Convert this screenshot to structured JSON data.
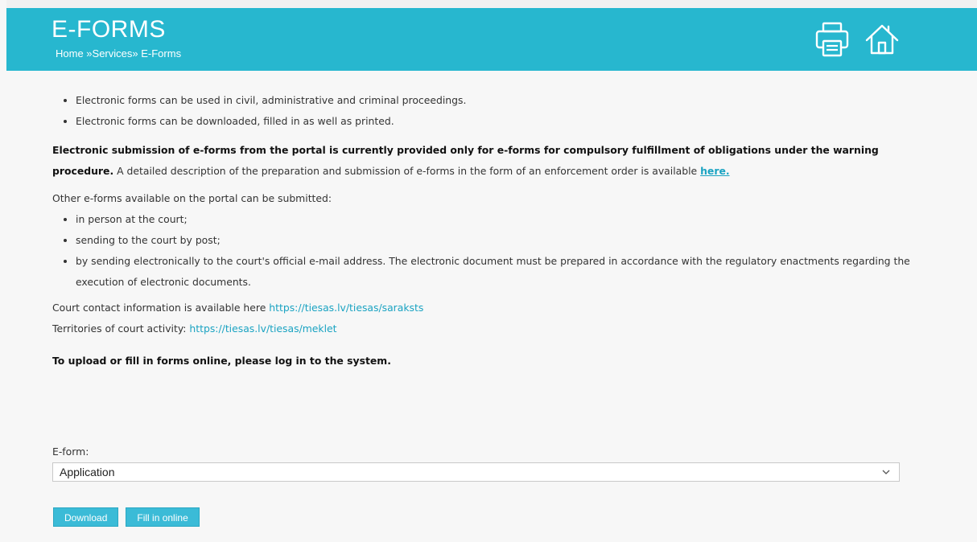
{
  "header": {
    "title": "E-FORMS",
    "breadcrumb": {
      "home": "Home",
      "sep1": " »",
      "services": "Services",
      "sep2": "» ",
      "current": "E-Forms"
    },
    "icons": [
      "printer-icon",
      "home-icon"
    ],
    "banner_color": "#27b7cf"
  },
  "content": {
    "intro_bullets": [
      "Electronic forms can be used in civil, administrative and criminal proceedings.",
      "Electronic forms can be downloaded, filled in as well as printed."
    ],
    "submission_bold": "Electronic submission of e-forms from the portal is currently provided only for e-forms for compulsory fulfillment of obligations under the warning procedure.",
    "submission_rest": " A detailed description of the preparation and submission of e-forms in the form of an enforcement order is available ",
    "submission_link": "here.",
    "other_intro": "Other e-forms available on the portal can be submitted:",
    "other_bullets": [
      "in person at the court;",
      "sending to the court by post;",
      "by sending electronically to the court's official e-mail address. The electronic document must be prepared in accordance with the regulatory enactments regarding the execution of electronic documents."
    ],
    "contact_label": "Court contact information is available here ",
    "contact_link": "https://tiesas.lv/tiesas/saraksts",
    "territories_label": "Territories of court activity: ",
    "territories_link": "https://tiesas.lv/tiesas/meklet",
    "login_notice": "To upload or fill in forms online, please log in to the system."
  },
  "form": {
    "label": "E-form:",
    "selected": "Application",
    "download_button": "Download",
    "fill_button": "Fill in online"
  },
  "colors": {
    "accent": "#27b7cf",
    "link": "#1aa3c2",
    "button": "#3bbbd7"
  }
}
